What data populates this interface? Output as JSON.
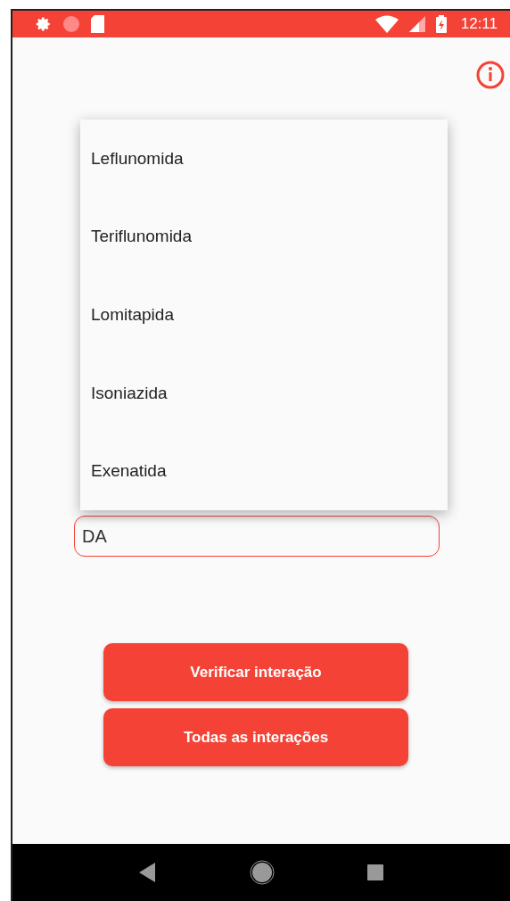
{
  "status_bar": {
    "time": "12:11"
  },
  "suggestions": [
    {
      "label": "Leflunomida"
    },
    {
      "label": "Teriflunomida"
    },
    {
      "label": "Lomitapida"
    },
    {
      "label": "Isoniazida"
    },
    {
      "label": "Exenatida"
    }
  ],
  "second_substance_field": {
    "value": "DA",
    "focused": true
  },
  "buttons": [
    {
      "label": "Verificar interação"
    },
    {
      "label": "Todas as interações"
    }
  ]
}
